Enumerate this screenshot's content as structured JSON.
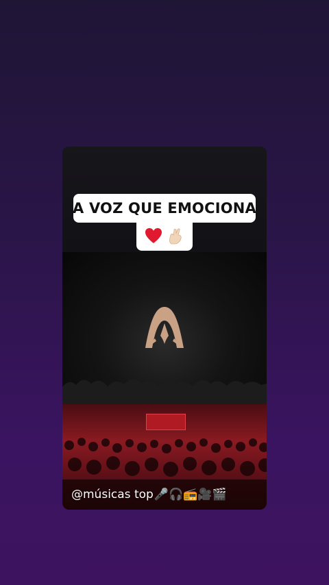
{
  "story": {
    "caption_line1": "A VOZ QUE EMOCIONA",
    "caption_emojis": [
      "heart",
      "crossed-fingers"
    ],
    "handle": "@músicas top",
    "footer_icons": [
      "microphone",
      "headphones",
      "radio",
      "movie-camera",
      "clapper-board"
    ],
    "footer_icons_text": "🎤🎧📻🎥🎬"
  },
  "colors": {
    "background_top": "#1f1535",
    "background_bottom": "#3d135f",
    "caption_bg": "#ffffff",
    "caption_text": "#111111",
    "logo_color": "#c9a184",
    "concert_red": "#8a1a22"
  }
}
